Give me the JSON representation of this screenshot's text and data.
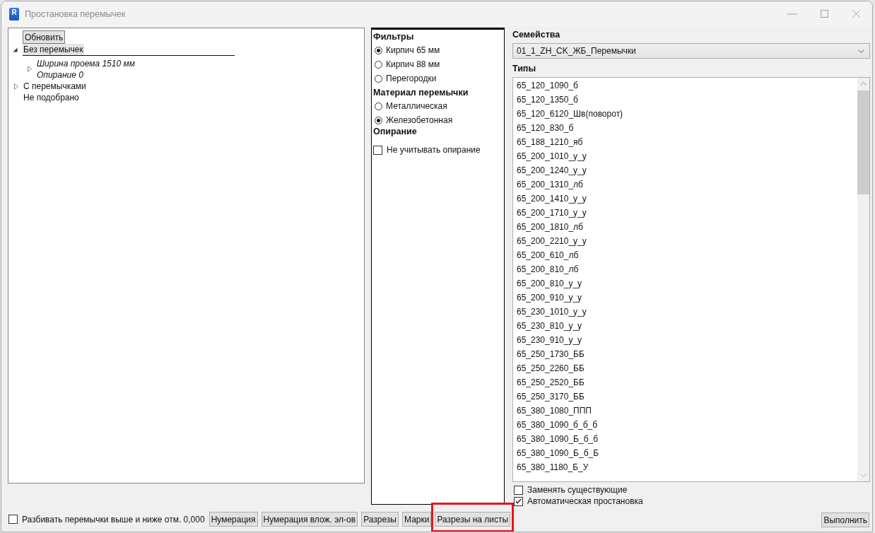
{
  "window": {
    "title": "Простановка перемычек",
    "app_icon_letter": "R",
    "active": false
  },
  "tree_panel": {
    "refresh_button": "Обновить",
    "items": [
      {
        "kind": "group",
        "label": "Без перемычек",
        "expandable": true,
        "expanded": true,
        "selected": true,
        "children": [
          {
            "kind": "detail",
            "lines": [
              "Ширина проема 1510 мм",
              "Опирание 0"
            ],
            "expandable": true,
            "expanded": false,
            "selected": false
          }
        ]
      },
      {
        "kind": "group",
        "label": "С перемычками",
        "expandable": true,
        "expanded": false,
        "selected": false
      },
      {
        "kind": "group",
        "label": "Не подобрано",
        "expandable": false,
        "selected": false
      }
    ]
  },
  "filters_panel": {
    "sections": [
      {
        "heading": "Фильтры",
        "kind": "radio",
        "options": [
          {
            "label": "Кирпич 65 мм",
            "selected": true
          },
          {
            "label": "Кирпич 88 мм",
            "selected": false
          },
          {
            "label": "Перегородки",
            "selected": false
          }
        ]
      },
      {
        "heading": "Материал перемычки",
        "kind": "radio",
        "options": [
          {
            "label": "Металлическая",
            "selected": false
          },
          {
            "label": "Железобетонная",
            "selected": true
          }
        ]
      },
      {
        "heading": "Опирание",
        "kind": "checkbox",
        "options": [
          {
            "label": "Не учитывать опирание",
            "checked": false
          }
        ]
      }
    ]
  },
  "families": {
    "label": "Семейства",
    "value": "01_1_ZH_CK_ЖБ_Перемычки"
  },
  "types": {
    "label": "Типы",
    "items": [
      {
        "label": "65_120_1090_б",
        "selected": false
      },
      {
        "label": "65_120_1350_б",
        "selected": false
      },
      {
        "label": "65_120_6120_Шв(поворот)",
        "selected": false
      },
      {
        "label": "65_120_830_б",
        "selected": false
      },
      {
        "label": "65_188_1210_яб",
        "selected": false
      },
      {
        "label": "65_200_1010_у_у",
        "selected": false
      },
      {
        "label": "65_200_1240_у_у",
        "selected": false
      },
      {
        "label": "65_200_1310_лб",
        "selected": false
      },
      {
        "label": "65_200_1410_у_у",
        "selected": false
      },
      {
        "label": "65_200_1710_у_у",
        "selected": false
      },
      {
        "label": "65_200_1810_лб",
        "selected": false
      },
      {
        "label": "65_200_2210_у_у",
        "selected": false
      },
      {
        "label": "65_200_610_лб",
        "selected": false
      },
      {
        "label": "65_200_810_лб",
        "selected": false
      },
      {
        "label": "65_200_810_у_у",
        "selected": false
      },
      {
        "label": "65_200_910_у_у",
        "selected": false
      },
      {
        "label": "65_230_1010_у_у",
        "selected": false
      },
      {
        "label": "65_230_810_у_у",
        "selected": false
      },
      {
        "label": "65_230_910_у_у",
        "selected": false
      },
      {
        "label": "65_250_1730_ББ",
        "selected": false
      },
      {
        "label": "65_250_2260_ББ",
        "selected": false
      },
      {
        "label": "65_250_2520_ББ",
        "selected": false
      },
      {
        "label": "65_250_3170_ББ",
        "selected": false
      },
      {
        "label": "65_380_1080_ППП",
        "selected": false
      },
      {
        "label": "65_380_1090_б_б_б",
        "selected": false
      },
      {
        "label": "65_380_1090_Б_б_б",
        "selected": false
      },
      {
        "label": "65_380_1090_Б_б_Б",
        "selected": false
      },
      {
        "label": "65_380_1180_Б_У",
        "selected": false
      }
    ]
  },
  "options": [
    {
      "label": "Заменять существующие",
      "checked": false
    },
    {
      "label": "Автоматическая простановка",
      "checked": true
    }
  ],
  "run_button": "Выполнить",
  "bottom_bar": {
    "split_checkbox": {
      "label": "Разбивать перемычки выше и ниже отм. 0,000",
      "checked": false
    },
    "buttons": [
      {
        "label": "Нумерация",
        "highlighted": false
      },
      {
        "label": "Нумерация влож. эл-ов",
        "highlighted": false
      },
      {
        "label": "Разрезы",
        "highlighted": false
      },
      {
        "label": "Марки",
        "highlighted": false
      },
      {
        "label": "Разрезы на листы",
        "highlighted": true
      }
    ]
  }
}
